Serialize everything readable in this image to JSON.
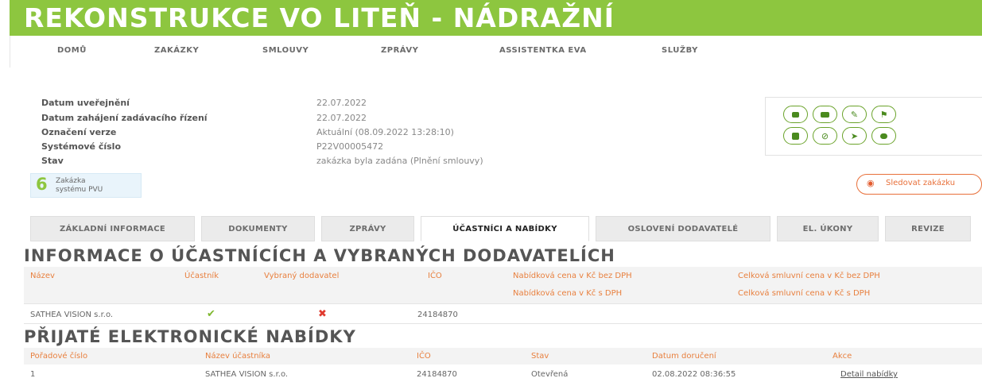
{
  "header": {
    "title": "REKONSTRUKCE VO LITEŇ - NÁDRAŽNÍ",
    "nav": [
      "DOMŮ",
      "ZAKÁZKY",
      "SMLOUVY",
      "ZPRÁVY",
      "ASSISTENTKA EVA",
      "SLUŽBY"
    ]
  },
  "info": {
    "labels": [
      "Datum uveřejnění",
      "Datum zahájení zadávacího řízení",
      "Označení verze",
      "Systémové číslo",
      "Stav"
    ],
    "values": [
      "22.07.2022",
      "22.07.2022",
      "Aktuální (08.09.2022 13:28:10)",
      "P22V00005472",
      "zakázka byla zadána (Plnění smlouvy)"
    ]
  },
  "pvu_badge": {
    "logo": "6",
    "line1": "Zakázka",
    "line2": "systému PVU"
  },
  "watch_button": {
    "label": "Sledovat zakázku"
  },
  "action_icons": [
    "note-icon",
    "folder-icon",
    "pencil-icon",
    "flag-icon",
    "printer-icon",
    "block-icon",
    "send-icon",
    "chat-icon"
  ],
  "tabs": [
    "ZÁKLADNÍ INFORMACE",
    "DOKUMENTY",
    "ZPRÁVY",
    "ÚČASTNÍCI A NABÍDKY",
    "OSLOVENÍ DODAVATELÉ",
    "EL. ÚKONY",
    "REVIZE"
  ],
  "active_tab": "ÚČASTNÍCI A NABÍDKY",
  "participants": {
    "heading": "INFORMACE O ÚČASTNÍCÍCH A VYBRANÝCH DODAVATELÍCH",
    "columns": [
      "Název",
      "Účastník",
      "Vybraný dodavatel",
      "IČO",
      "Nabídková cena v Kč bez DPH",
      "Nabídková cena v Kč s DPH",
      "Celková smluvní cena v Kč bez DPH",
      "Celková smluvní cena v Kč s DPH"
    ],
    "rows": [
      {
        "name": "SATHEA VISION s.r.o.",
        "participant": "✔",
        "selected": "✖",
        "ico": "24184870"
      }
    ]
  },
  "offers": {
    "heading": "PŘIJATÉ ELEKTRONICKÉ NABÍDKY",
    "columns": [
      "Pořadové číslo",
      "Název účastníka",
      "IČO",
      "Stav",
      "Datum doručení",
      "Akce"
    ],
    "rows": [
      {
        "order": "1",
        "name": "SATHEA VISION s.r.o.",
        "ico": "24184870",
        "state": "Otevřená",
        "date": "02.08.2022 08:36:55",
        "action": "Detail nabídky"
      }
    ]
  },
  "colors": {
    "brand_green": "#8dc63f",
    "accent_orange": "#e8803f",
    "icon_green": "#6aa32a",
    "error_red": "#e03a2f"
  }
}
